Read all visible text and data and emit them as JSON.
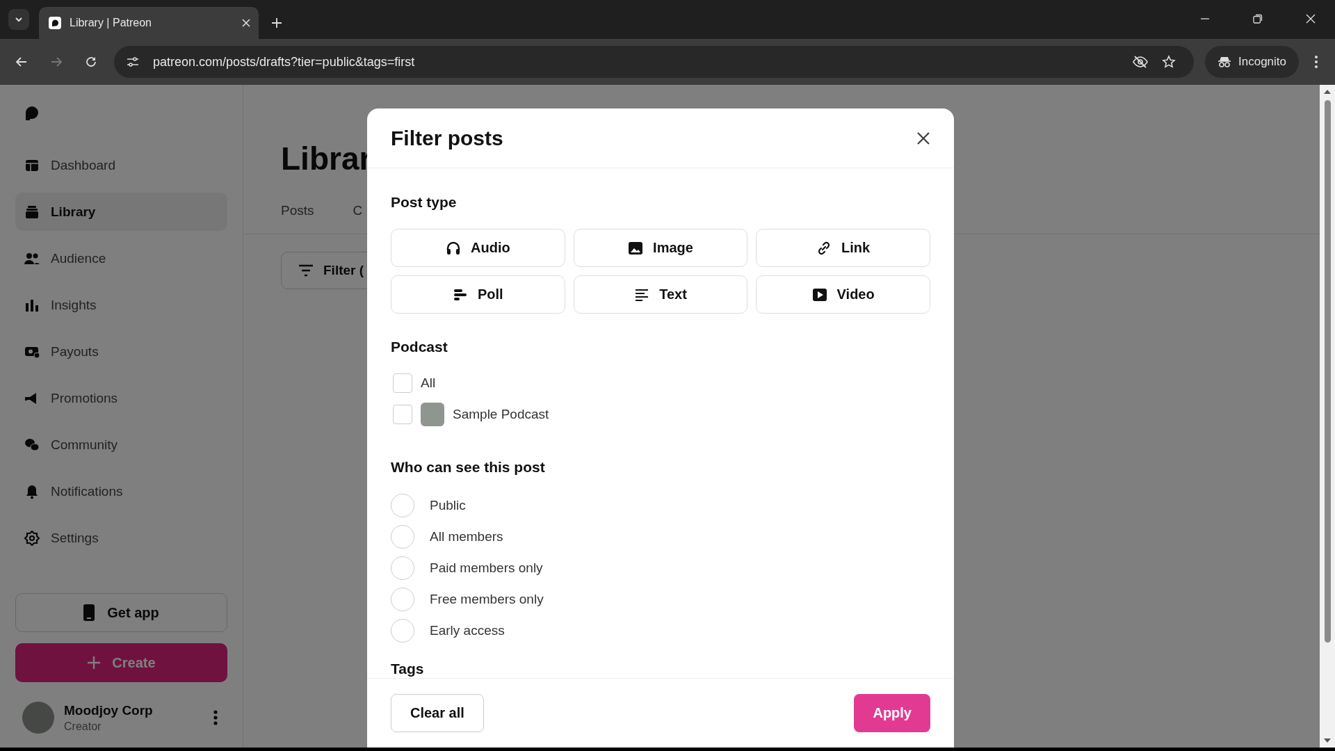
{
  "browser": {
    "tab_title": "Library | Patreon",
    "url": "patreon.com/posts/drafts?tier=public&tags=first",
    "profile": "Incognito"
  },
  "sidebar": {
    "items": [
      {
        "label": "Dashboard",
        "kind": "dashboard",
        "selected": false
      },
      {
        "label": "Library",
        "kind": "library",
        "selected": true
      },
      {
        "label": "Audience",
        "kind": "audience",
        "selected": false
      },
      {
        "label": "Insights",
        "kind": "insights",
        "selected": false
      },
      {
        "label": "Payouts",
        "kind": "payouts",
        "selected": false
      },
      {
        "label": "Promotions",
        "kind": "promotions",
        "selected": false
      },
      {
        "label": "Community",
        "kind": "community",
        "selected": false
      },
      {
        "label": "Notifications",
        "kind": "notifications",
        "selected": false
      },
      {
        "label": "Settings",
        "kind": "settings",
        "selected": false
      }
    ],
    "get_app": "Get app",
    "create": "Create",
    "user": {
      "name": "Moodjoy Corp",
      "role": "Creator"
    }
  },
  "page": {
    "title": "Librar",
    "tabs": [
      "Posts",
      "C"
    ],
    "filter_button": "Filter ("
  },
  "modal": {
    "title": "Filter posts",
    "post_type": {
      "heading": "Post type",
      "options": [
        {
          "label": "Audio",
          "kind": "audio",
          "selected": false
        },
        {
          "label": "Image",
          "kind": "image",
          "selected": false
        },
        {
          "label": "Link",
          "kind": "link",
          "selected": false
        },
        {
          "label": "Poll",
          "kind": "poll",
          "selected": false
        },
        {
          "label": "Text",
          "kind": "text",
          "selected": false
        },
        {
          "label": "Video",
          "kind": "video",
          "selected": false
        }
      ]
    },
    "podcast": {
      "heading": "Podcast",
      "options": [
        {
          "label": "All",
          "kind": "plain",
          "checked": false
        },
        {
          "label": "Sample Podcast",
          "kind": "with-cover",
          "checked": false
        }
      ]
    },
    "visibility": {
      "heading": "Who can see this post",
      "options": [
        {
          "label": "Public",
          "selected": false
        },
        {
          "label": "All members",
          "selected": false
        },
        {
          "label": "Paid members only",
          "selected": false
        },
        {
          "label": "Free members only",
          "selected": false
        },
        {
          "label": "Early access",
          "selected": false
        }
      ]
    },
    "tags": {
      "heading": "Tags"
    },
    "clear_button": "Clear all",
    "apply_button": "Apply"
  }
}
